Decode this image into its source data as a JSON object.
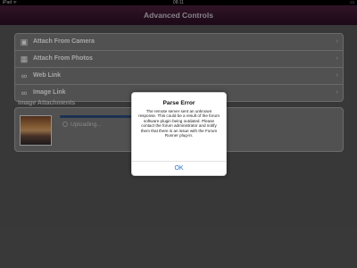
{
  "status_bar": {
    "left": "iPad ᯤ",
    "time": "08:11",
    "right": "▭"
  },
  "navbar": {
    "title": "Advanced Controls"
  },
  "list": {
    "items": [
      {
        "label": "Attach From Camera",
        "icon": "camera-icon"
      },
      {
        "label": "Attach From Photos",
        "icon": "photos-icon"
      },
      {
        "label": "Web Link",
        "icon": "link-icon"
      },
      {
        "label": "Image Link",
        "icon": "link-icon"
      }
    ]
  },
  "attachments": {
    "section_title": "Image Attachments",
    "status_text": "Uploading..."
  },
  "alert": {
    "title": "Parse Error",
    "message": "The remote server sent an unknown response.  This could be a result of the forum software plugin being outdated.  Please contact the forum administrator and notify them that there is an issue with the Forum Runner plug-in.",
    "ok_label": "OK"
  },
  "colors": {
    "navbar": "#3a1731",
    "accent": "#1f6fd3",
    "background": "#575757"
  }
}
